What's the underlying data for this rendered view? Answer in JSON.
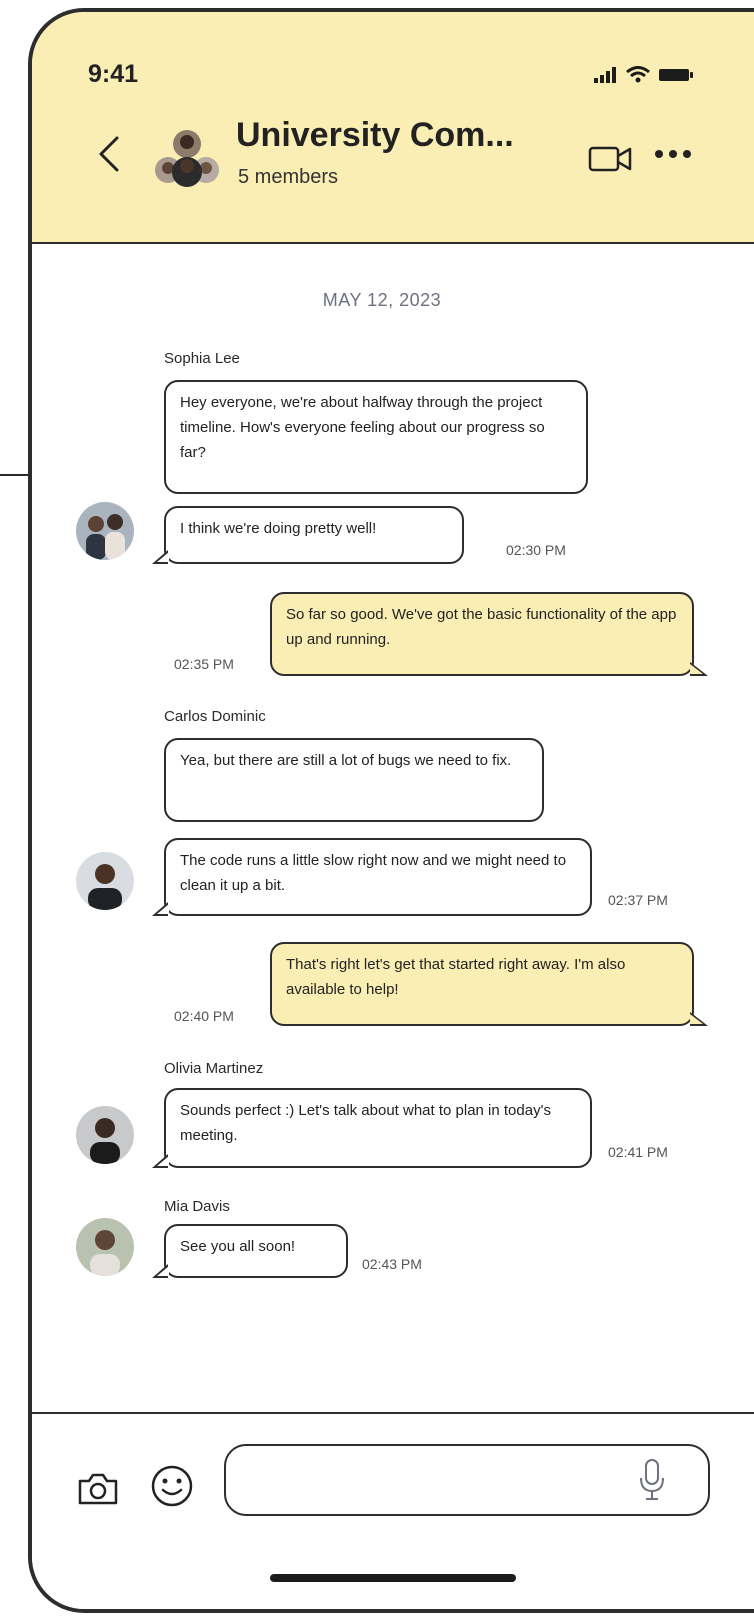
{
  "status_bar": {
    "time": "9:41",
    "icons": [
      "signal-icon",
      "wifi-icon",
      "battery-icon"
    ]
  },
  "header": {
    "title": "University Com...",
    "subtitle": "5 members",
    "icons": [
      "back-icon",
      "video-call-icon",
      "more-icon"
    ]
  },
  "date_divider": "MAY 12, 2023",
  "messages": [
    {
      "sender": "Sophia Lee",
      "text": "Hey everyone, we're about halfway through the project timeline. How's everyone feeling about our progress so far?",
      "time": ""
    },
    {
      "sender": "",
      "text": "I think we're doing pretty well!",
      "time": "02:30 PM"
    },
    {
      "sender": "me",
      "text": "So far so good. We've got the basic functionality of the app up and running.",
      "time": "02:35 PM"
    },
    {
      "sender": "Carlos Dominic",
      "text": "Yea, but there are still a lot of bugs we need to fix.",
      "time": ""
    },
    {
      "sender": "",
      "text": "The code runs a little slow right now and we might need to clean it up a bit.",
      "time": "02:37 PM"
    },
    {
      "sender": "me",
      "text": "That's right let's get that started right away. I'm also available to help!",
      "time": "02:40 PM"
    },
    {
      "sender": "Olivia Martinez",
      "text": "Sounds perfect :) Let's talk about what to plan in today's meeting.",
      "time": "02:41 PM"
    },
    {
      "sender": "Mia Davis",
      "text": "See you all soon!",
      "time": "02:43 PM"
    }
  ],
  "composer": {
    "value": "",
    "placeholder": "",
    "icons": [
      "camera-icon",
      "emoji-icon",
      "microphone-icon"
    ]
  },
  "colors": {
    "accent": "#fbeeb4",
    "outline": "#2d2d2d",
    "date_text": "#6d7180"
  }
}
